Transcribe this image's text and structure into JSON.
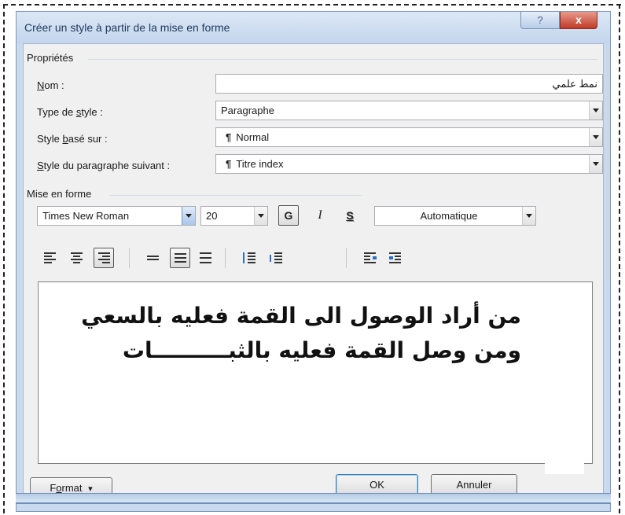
{
  "window": {
    "title": "Créer un style à partir de la mise en forme",
    "help_label": "?",
    "close_label": "x"
  },
  "properties": {
    "section_label": "Propriétés",
    "name_label_key": "N",
    "name_label_rest": "om :",
    "name_value": "نمط علمي",
    "style_type_label_pre": "Type de ",
    "style_type_label_key": "s",
    "style_type_label_post": "tyle :",
    "style_type_value": "Paragraphe",
    "based_on_label_pre": "Style ",
    "based_on_label_key": "b",
    "based_on_label_post": "asé sur :",
    "based_on_value": "Normal",
    "next_style_label_key": "S",
    "next_style_label_post": "tyle du paragraphe suivant :",
    "next_style_value": "Titre index",
    "pilcrow": "¶"
  },
  "formatting": {
    "section_label": "Mise en forme",
    "font_name": "Times New Roman",
    "font_size": "20",
    "bold_label": "G",
    "italic_label": "I",
    "shadow_label": "S",
    "color_value": "Automatique",
    "alignment_selected": "right",
    "spacing_selected": "double"
  },
  "preview": {
    "line1": "من أراد الوصول الى القمة فعليه بالسعي",
    "line2": "ومن وصل القمة فعليه بالثبــــــــــات"
  },
  "buttons": {
    "format_pre": "F",
    "format_key": "o",
    "format_post": "rmat",
    "format_arrow": "▾",
    "ok_label": "OK",
    "cancel_label": "Annuler"
  },
  "colors": {
    "titlebar": "#c4d6ee",
    "close_button": "#c13a26",
    "dialog_background": "#f0f0f0"
  }
}
